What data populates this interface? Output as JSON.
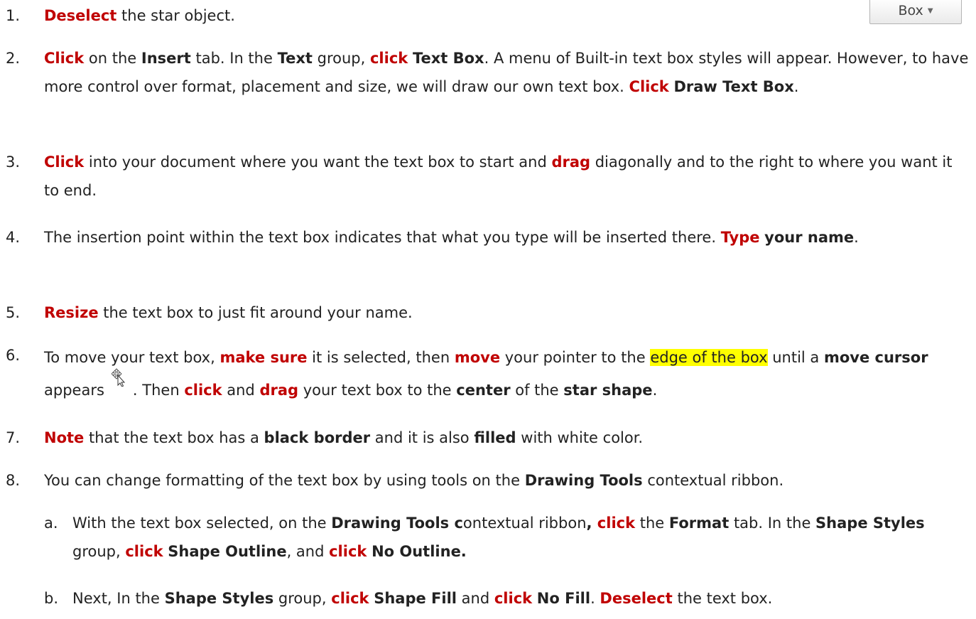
{
  "ribbon": {
    "box_label": "Box",
    "dropdown_icon": "chevron-down-icon"
  },
  "steps": [
    {
      "num": "1.",
      "parts": [
        {
          "t": "Deselect",
          "s": "act"
        },
        {
          "t": " the star object."
        }
      ]
    },
    {
      "num": "2.",
      "parts": [
        {
          "t": "Click",
          "s": "act"
        },
        {
          "t": " on the "
        },
        {
          "t": "Insert",
          "s": "b"
        },
        {
          "t": " tab. In the "
        },
        {
          "t": "Text",
          "s": "b"
        },
        {
          "t": " group, "
        },
        {
          "t": "click",
          "s": "act"
        },
        {
          "t": " "
        },
        {
          "t": "Text Box",
          "s": "b"
        },
        {
          "t": ". A menu of Built-in text box styles will appear. However, to have more control over format, placement and size, we will draw our own text box. "
        },
        {
          "t": "Click",
          "s": "act"
        },
        {
          "t": " "
        },
        {
          "t": "Draw Text Box",
          "s": "b"
        },
        {
          "t": "."
        }
      ]
    },
    {
      "num": "3.",
      "parts": [
        {
          "t": "Click",
          "s": "act"
        },
        {
          "t": " into your document where you want the text box to start and "
        },
        {
          "t": "drag",
          "s": "act"
        },
        {
          "t": " diagonally and to the right to where you want it to end."
        }
      ]
    },
    {
      "num": "4.",
      "parts": [
        {
          "t": "The insertion point within the text box indicates that what you type will be inserted there.  "
        },
        {
          "t": "Type",
          "s": "act"
        },
        {
          "t": " "
        },
        {
          "t": "your name",
          "s": "b"
        },
        {
          "t": "."
        }
      ]
    },
    {
      "num": "5.",
      "parts": [
        {
          "t": "Resize",
          "s": "act"
        },
        {
          "t": " the text box to just fit around your name."
        }
      ]
    },
    {
      "num": "6.",
      "parts": [
        {
          "t": "To move your text box, "
        },
        {
          "t": "make sure",
          "s": "act"
        },
        {
          "t": " it is selected, then "
        },
        {
          "t": "move",
          "s": "act"
        },
        {
          "t": " your pointer to the "
        },
        {
          "t": "edge of the box",
          "s": "hl"
        },
        {
          "t": " until a "
        },
        {
          "t": "move cursor",
          "s": "b"
        },
        {
          "t": " appears"
        },
        {
          "icon": "move-cursor-icon"
        },
        {
          "t": ".  Then "
        },
        {
          "t": "click",
          "s": "act"
        },
        {
          "t": " and "
        },
        {
          "t": "drag",
          "s": "act"
        },
        {
          "t": " your text box to the "
        },
        {
          "t": "center",
          "s": "b"
        },
        {
          "t": " of the "
        },
        {
          "t": "star shape",
          "s": "b"
        },
        {
          "t": "."
        }
      ]
    },
    {
      "num": "7.",
      "parts": [
        {
          "t": "Note",
          "s": "act"
        },
        {
          "t": " that the text box has a "
        },
        {
          "t": "black border",
          "s": "b"
        },
        {
          "t": " and it is also "
        },
        {
          "t": "filled",
          "s": "b"
        },
        {
          "t": " with white color."
        }
      ]
    },
    {
      "num": "8.",
      "parts": [
        {
          "t": "You can change formatting of the text box by using tools on the "
        },
        {
          "t": "Drawing Tools",
          "s": "b"
        },
        {
          "t": " contextual ribbon."
        }
      ]
    },
    {
      "num": "a.",
      "sub": true,
      "parts": [
        {
          "t": "With the text box selected, on the "
        },
        {
          "t": "Drawing Tools c",
          "s": "b"
        },
        {
          "t": "ontextual ribbon"
        },
        {
          "t": ", ",
          "s": "b"
        },
        {
          "t": "click",
          "s": "act"
        },
        {
          "t": " the "
        },
        {
          "t": "Format",
          "s": "b"
        },
        {
          "t": " tab. In the "
        },
        {
          "t": "Shape Styles",
          "s": "b"
        },
        {
          "t": " group, "
        },
        {
          "t": "click",
          "s": "act"
        },
        {
          "t": " "
        },
        {
          "t": "Shape Outline",
          "s": "b"
        },
        {
          "t": ", and "
        },
        {
          "t": "click",
          "s": "act"
        },
        {
          "t": " "
        },
        {
          "t": "No Outline.",
          "s": "b"
        }
      ]
    },
    {
      "num": "b.",
      "sub": true,
      "parts": [
        {
          "t": "Next, In the "
        },
        {
          "t": "Shape Styles",
          "s": "b"
        },
        {
          "t": " group, "
        },
        {
          "t": "click",
          "s": "act"
        },
        {
          "t": " "
        },
        {
          "t": "Shape Fill",
          "s": "b"
        },
        {
          "t": " and "
        },
        {
          "t": "click",
          "s": "act"
        },
        {
          "t": " "
        },
        {
          "t": "No Fill",
          "s": "b"
        },
        {
          "t": ". "
        },
        {
          "t": "Deselect",
          "s": "act"
        },
        {
          "t": " the text box."
        }
      ]
    }
  ],
  "colors": {
    "action": "#c00000",
    "highlight": "#ffff00",
    "text": "#222222"
  }
}
